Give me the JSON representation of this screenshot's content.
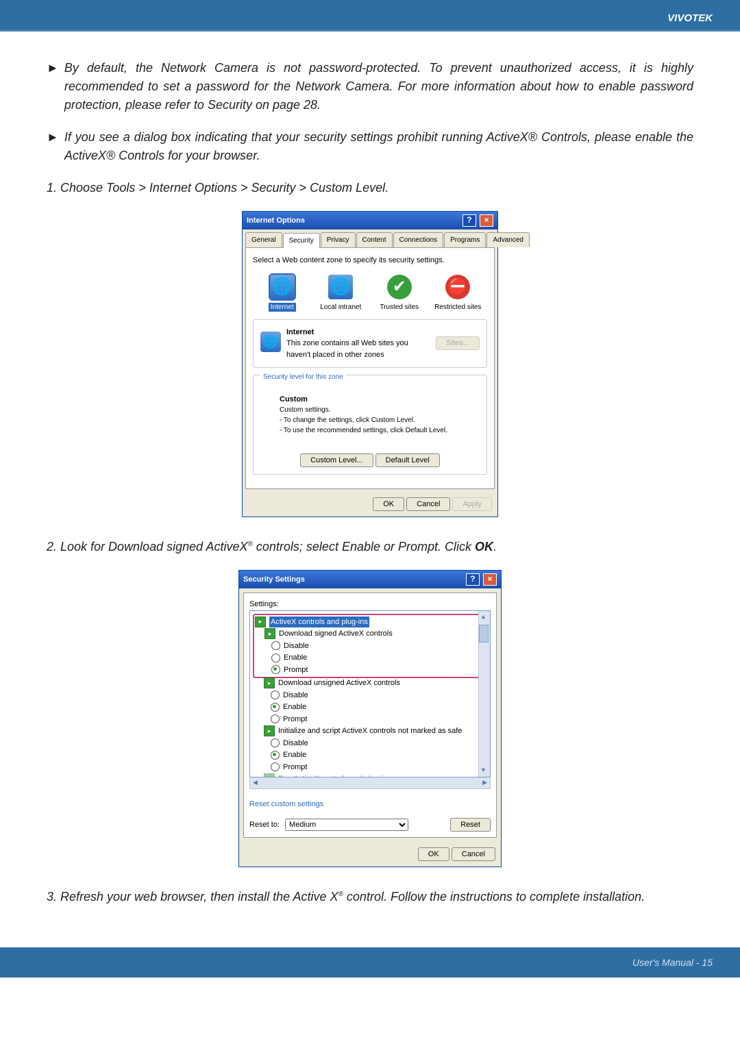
{
  "header": {
    "brand": "VIVOTEK"
  },
  "footer": {
    "text": "User's Manual - 15"
  },
  "bullets": [
    "By default, the Network Camera is not password-protected. To prevent unauthorized access, it is highly recommended to set a password for the Network Camera.\nFor more information about how to enable password protection, please refer to Security on page 28.",
    "If you see a dialog box indicating that your security settings prohibit running ActiveX® Controls, please enable the ActiveX® Controls for your browser."
  ],
  "steps": {
    "s1": "1. Choose Tools > Internet Options > Security > Custom Level.",
    "s2_pre": "2. Look for Download signed ActiveX",
    "s2_post": " controls; select Enable or Prompt. Click ",
    "s2_bold": "OK",
    "s3_pre": "3. Refresh your web browser, then install the Active X",
    "s3_post": " control. Follow the instructions to complete installation."
  },
  "dialog1": {
    "title": "Internet Options",
    "tabs": [
      "General",
      "Security",
      "Privacy",
      "Content",
      "Connections",
      "Programs",
      "Advanced"
    ],
    "instruct": "Select a Web content zone to specify its security settings.",
    "zones": [
      "Internet",
      "Local intranet",
      "Trusted sites",
      "Restricted sites"
    ],
    "zone_head": "Internet",
    "zone_desc": "This zone contains all Web sites you haven't placed in other zones",
    "sites_btn": "Sites...",
    "sec_label": "Security level for this zone",
    "custom_h": "Custom",
    "custom_d1": "Custom settings.",
    "custom_d2": "- To change the settings, click Custom Level.",
    "custom_d3": "- To use the recommended settings, click Default Level.",
    "btn_custom": "Custom Level...",
    "btn_default": "Default Level",
    "ok": "OK",
    "cancel": "Cancel",
    "apply": "Apply"
  },
  "dialog2": {
    "title": "Security Settings",
    "settings_lbl": "Settings:",
    "group": "ActiveX controls and plug-ins",
    "items": [
      {
        "label": "Download signed ActiveX controls",
        "opts": [
          "Disable",
          "Enable",
          "Prompt"
        ],
        "selected": 2
      },
      {
        "label": "Download unsigned ActiveX controls",
        "opts": [
          "Disable",
          "Enable",
          "Prompt"
        ],
        "selected": 1
      },
      {
        "label": "Initialize and script ActiveX controls not marked as safe",
        "opts": [
          "Disable",
          "Enable",
          "Prompt"
        ],
        "selected": 1
      }
    ],
    "cut_line": "Run ActiveX controls and plug-ins",
    "reset_label": "Reset custom settings",
    "reset_to": "Reset to:",
    "reset_val": "Medium",
    "reset_btn": "Reset",
    "ok": "OK",
    "cancel": "Cancel"
  }
}
